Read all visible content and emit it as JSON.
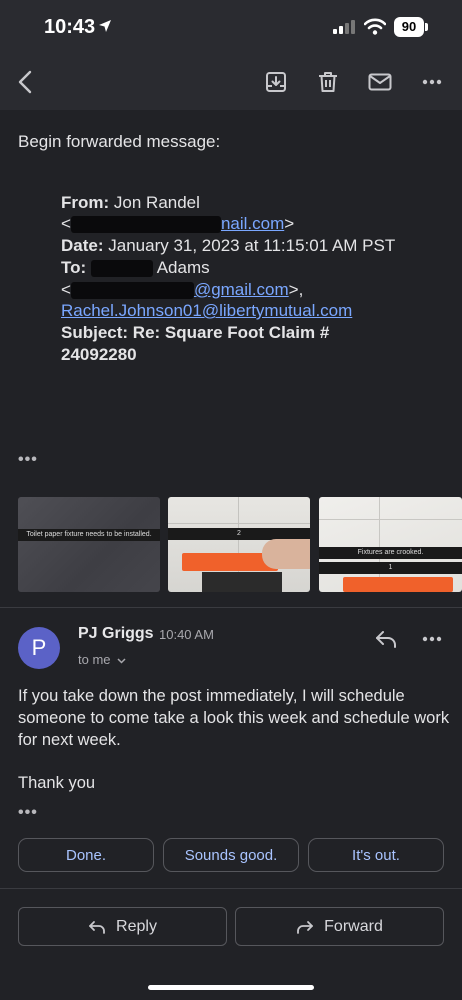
{
  "status": {
    "time": "10:43",
    "battery": "90"
  },
  "icons": {
    "location": "location-arrow-icon",
    "signal": "cellular-signal-icon",
    "wifi": "wifi-icon",
    "back": "back-arrow-icon",
    "archive": "archive-icon",
    "delete": "trash-icon",
    "unread": "mail-icon",
    "more": "more-horizontal-icon",
    "reply": "reply-icon",
    "forward": "forward-icon",
    "chevron": "chevron-down-icon"
  },
  "forwarded": {
    "intro": "Begin forwarded message:",
    "from_label": "From:",
    "from_name": "Jon Randel",
    "from_email_open": "<",
    "from_email_visible": "nail.com",
    "from_email_close": ">",
    "date_label": "Date:",
    "date_value": "January 31, 2023 at 11:15:01 AM PST",
    "to_label": "To:",
    "to_name_visible": "Adams",
    "to_email_open": "<",
    "to_email_visible": "@gmail.com",
    "to_email_close": ">,",
    "to_email2": "Rachel.Johnson01@libertymutual.com",
    "subject_label": "Subject:",
    "subject_line1": "Re: Square Foot Claim #",
    "subject_line2": "24092280",
    "dots": "•••"
  },
  "attachments": [
    {
      "caption": "Toilet paper fixture needs to be installed."
    },
    {
      "caption": "2"
    },
    {
      "caption": "Fixtures are crooked.",
      "number": "1"
    }
  ],
  "message": {
    "avatar_letter": "P",
    "sender": "PJ Griggs",
    "time": "10:40 AM",
    "recipient": "to me",
    "body": "If you take down the post immediately, I will schedule someone to come take a look this week and schedule work for next week.",
    "signoff": "Thank you",
    "dots": "•••"
  },
  "smart_replies": [
    "Done.",
    "Sounds good.",
    "It's out."
  ],
  "actions": {
    "reply": "Reply",
    "forward": "Forward"
  },
  "colors": {
    "background": "#212226",
    "bar": "#2a2b30",
    "link": "#7aa7ff",
    "chip_text": "#a9c4ff",
    "avatar": "#5b62c7"
  }
}
